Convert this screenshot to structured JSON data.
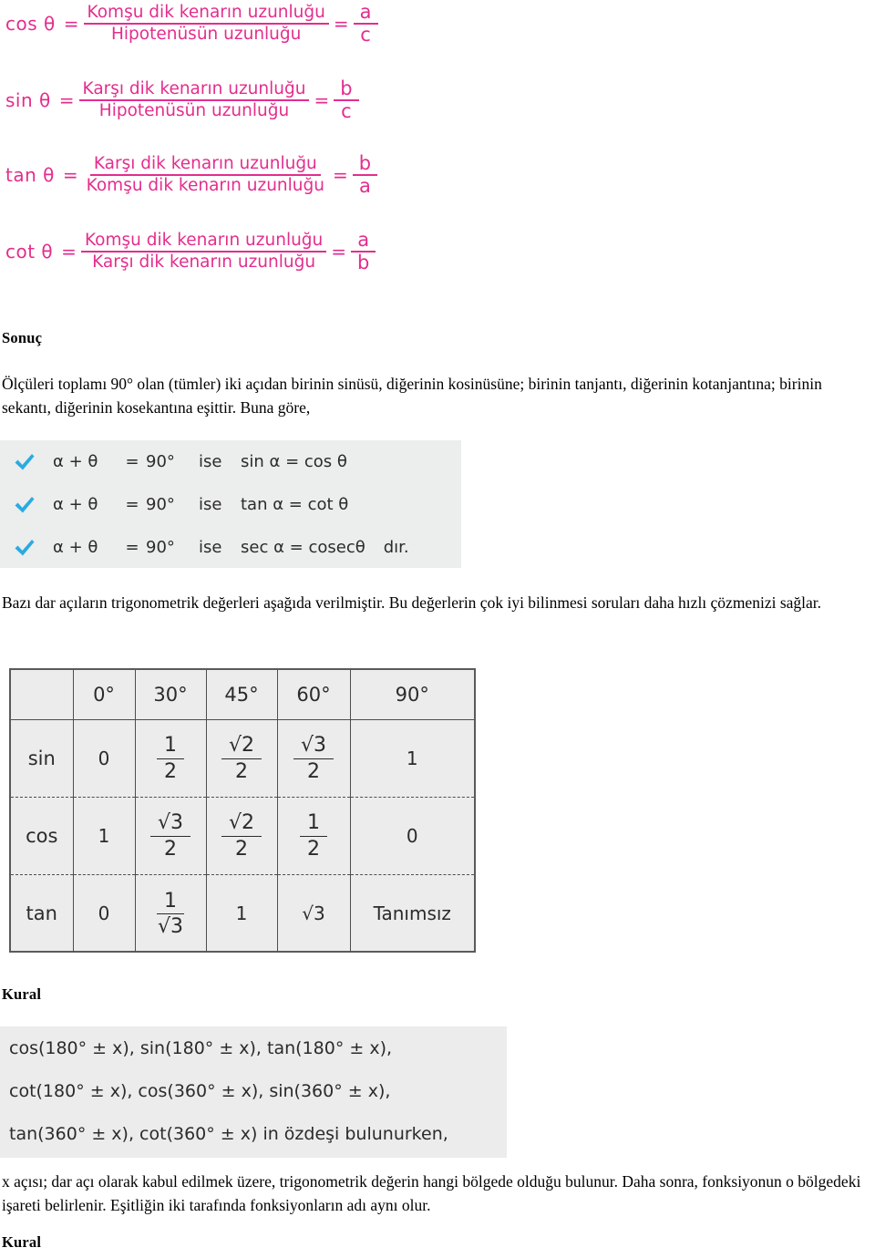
{
  "document": {
    "language": "tr",
    "accent_pink": "#e42d8d",
    "check_blue": "#29abe2",
    "panel_gray": "#ececec"
  },
  "formulas": {
    "ratios": [
      {
        "lhs": "cos θ",
        "eq": "=",
        "num": "Komşu dik kenarın uzunluğu",
        "den": "Hipotenüsün uzunluğu",
        "eq2": "=",
        "rnum": "a",
        "rden": "c"
      },
      {
        "lhs": "sin θ",
        "eq": "=",
        "num": "Karşı dik kenarın uzunluğu",
        "den": "Hipotenüsün uzunluğu",
        "eq2": "=",
        "rnum": "b",
        "rden": "c"
      },
      {
        "lhs": "tan θ",
        "eq": "=",
        "num": "Karşı dik kenarın uzunluğu",
        "den": "Komşu dik kenarın uzunluğu",
        "eq2": "=",
        "rnum": "b",
        "rden": "a"
      },
      {
        "lhs": "cot θ",
        "eq": "=",
        "num": "Komşu dik kenarın uzunluğu",
        "den": "Karşı dik kenarın uzunluğu",
        "eq2": "=",
        "rnum": "a",
        "rden": "b"
      }
    ]
  },
  "sonuc": {
    "heading": "Sonuç",
    "paragraph": "Ölçüleri toplamı 90° olan (tümler) iki açıdan birinin sinüsü, diğerinin kosinüsüne; birinin tanjantı, diğerinin kotanjantına; birinin sekantı, diğerinin kosekantına eşittir. Buna göre,"
  },
  "identities_panel": {
    "rows": [
      {
        "icon": "check-icon",
        "alpha": "α + θ",
        "eq": "=",
        "degree": "90°",
        "ise": "ise",
        "identity": "sin α = cos θ",
        "suffix": ""
      },
      {
        "icon": "check-icon",
        "alpha": "α + θ",
        "eq": "=",
        "degree": "90°",
        "ise": "ise",
        "identity": "tan α = cot θ",
        "suffix": ""
      },
      {
        "icon": "check-icon",
        "alpha": "α + θ",
        "eq": "=",
        "degree": "90°",
        "ise": "ise",
        "identity": "sec α = cosecθ",
        "suffix": "dır."
      }
    ]
  },
  "intro_table_text": {
    "paragraph": "Bazı dar açıların trigonometrik değerleri aşağıda verilmiştir. Bu değerlerin çok iyi bilinmesi soruları daha hızlı çözmenizi sağlar."
  },
  "chart_data": {
    "type": "table",
    "title": "Bazı dar açıların trigonometrik değerleri",
    "corner": "",
    "categories": [
      "0°",
      "30°",
      "45°",
      "60°",
      "90°"
    ],
    "rows": [
      {
        "label": "sin",
        "cells": [
          {
            "kind": "plain",
            "text": "0"
          },
          {
            "kind": "frac",
            "num": "1",
            "den": "2"
          },
          {
            "kind": "frac",
            "num": "√2",
            "den": "2"
          },
          {
            "kind": "frac",
            "num": "√3",
            "den": "2"
          },
          {
            "kind": "plain",
            "text": "1"
          }
        ],
        "values": [
          "0",
          "1/2",
          "√2/2",
          "√3/2",
          "1"
        ]
      },
      {
        "label": "cos",
        "cells": [
          {
            "kind": "plain",
            "text": "1"
          },
          {
            "kind": "frac",
            "num": "√3",
            "den": "2"
          },
          {
            "kind": "frac",
            "num": "√2",
            "den": "2"
          },
          {
            "kind": "frac",
            "num": "1",
            "den": "2"
          },
          {
            "kind": "plain",
            "text": "0"
          }
        ],
        "values": [
          "1",
          "√3/2",
          "√2/2",
          "1/2",
          "0"
        ]
      },
      {
        "label": "tan",
        "cells": [
          {
            "kind": "plain",
            "text": "0"
          },
          {
            "kind": "frac",
            "num": "1",
            "den": "√3"
          },
          {
            "kind": "plain",
            "text": "1"
          },
          {
            "kind": "plain",
            "text": "√3"
          },
          {
            "kind": "plain",
            "text": "Tanımsız"
          }
        ],
        "values": [
          "0",
          "1/√3",
          "1",
          "√3",
          "Tanımsız"
        ]
      }
    ]
  },
  "kural_1": {
    "heading": "Kural",
    "lines": [
      "cos(180° ± x), sin(180° ± x), tan(180° ± x),",
      "cot(180° ± x), cos(360° ± x), sin(360° ± x),",
      "tan(360° ± x), cot(360° ± x) in özdeşi bulunurken,"
    ],
    "paragraph": "x açısı; dar açı olarak kabul edilmek üzere, trigonometrik değerin hangi bölgede olduğu bulunur. Daha sonra, fonksiyonun o bölgedeki işareti belirlenir. Eşitliğin iki tarafında fonksiyonların adı aynı olur."
  },
  "kural_2": {
    "heading": "Kural"
  }
}
